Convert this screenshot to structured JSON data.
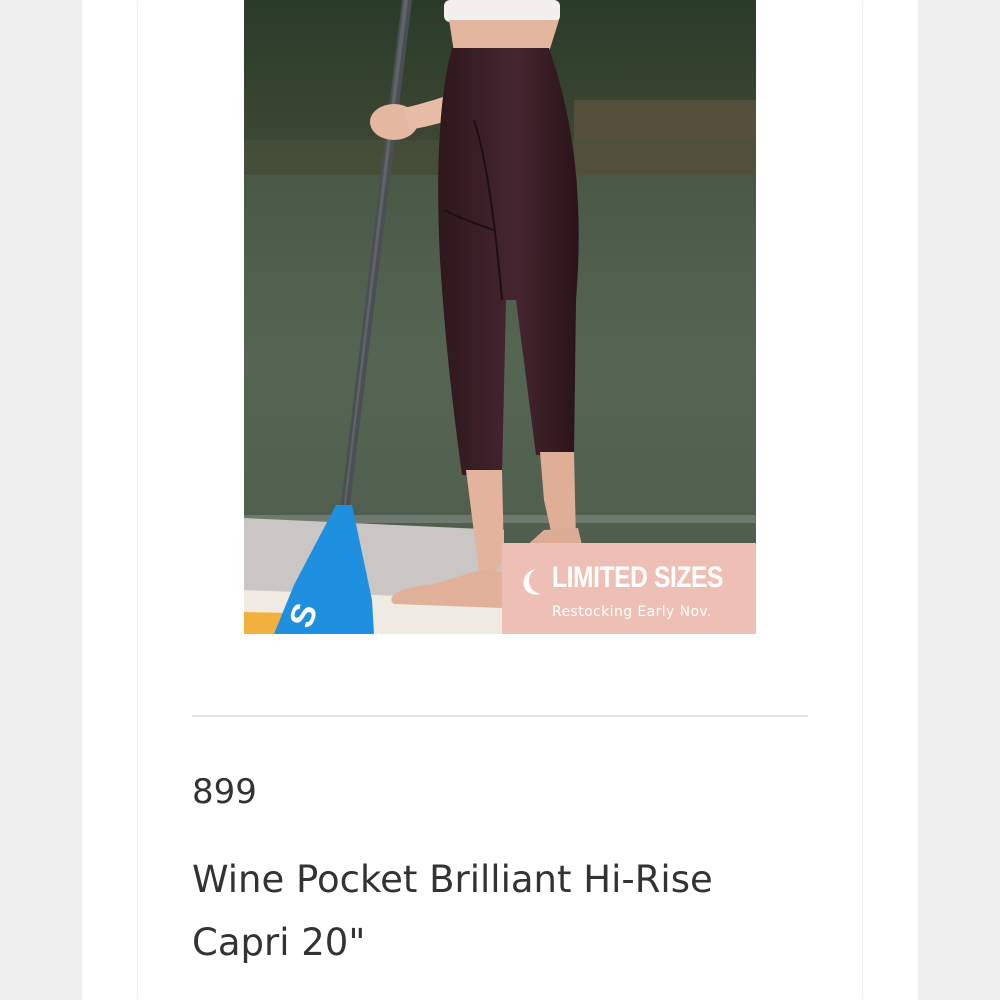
{
  "product": {
    "sku": "899",
    "title": "Wine Pocket Brilliant Hi-Rise Capri 20\""
  },
  "badge": {
    "title": "LIMITED SIZES",
    "subtitle": "Restocking Early Nov.",
    "icon": "crescent-moon-icon"
  },
  "paddle_text": "S",
  "colors": {
    "badge_bg": "#eebfb4",
    "text": "#333333",
    "divider": "#e3e3e3",
    "page_bg": "#f0f0f0",
    "leggings": "#3a1f26",
    "paddle_blade": "#1f8fe0"
  }
}
